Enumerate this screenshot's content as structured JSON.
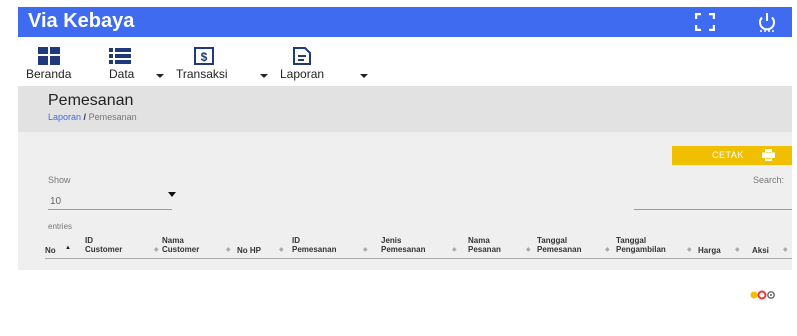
{
  "header": {
    "title": "Via Kebaya",
    "fullscreen_icon": "fullscreen-icon",
    "power_icon": "power-icon",
    "bar_color": "#3f6bf0"
  },
  "nav": {
    "items": [
      {
        "label": "Beranda",
        "icon": "dashboard-icon",
        "dropdown": false
      },
      {
        "label": "Data",
        "icon": "list-icon",
        "dropdown": true
      },
      {
        "label": "Transaksi",
        "icon": "money-icon",
        "dropdown": true
      },
      {
        "label": "Laporan",
        "icon": "report-icon",
        "dropdown": true
      }
    ]
  },
  "page": {
    "title": "Pemesanan",
    "breadcrumb": {
      "parent": "Laporan",
      "separator": "/",
      "current": "Pemesanan"
    }
  },
  "toolbar": {
    "print_label": "CETAK",
    "print_icon": "printer-icon",
    "button_color": "#f0c000"
  },
  "table": {
    "show_label": "Show",
    "page_length": "10",
    "entries_label": "entries",
    "search_label": "Search:",
    "columns": [
      "No",
      "ID Customer",
      "Nama Customer",
      "No HP",
      "ID Pemesanan",
      "Jenis Pemesanan",
      "Nama Pesanan",
      "Tanggal Pemesanan",
      "Tanggal Pengambilan",
      "Harga",
      "Aksi"
    ],
    "columns_lines": [
      [
        "No"
      ],
      [
        "ID",
        "Customer"
      ],
      [
        "Nama",
        "Customer"
      ],
      [
        "No HP"
      ],
      [
        "ID",
        "Pemesanan"
      ],
      [
        "Jenis",
        "Pemesanan"
      ],
      [
        "Nama",
        "Pesanan"
      ],
      [
        "Tanggal",
        "Pemesanan"
      ],
      [
        "Tanggal",
        "Pengambilan"
      ],
      [
        "Harga"
      ],
      [
        "Aksi"
      ]
    ]
  }
}
